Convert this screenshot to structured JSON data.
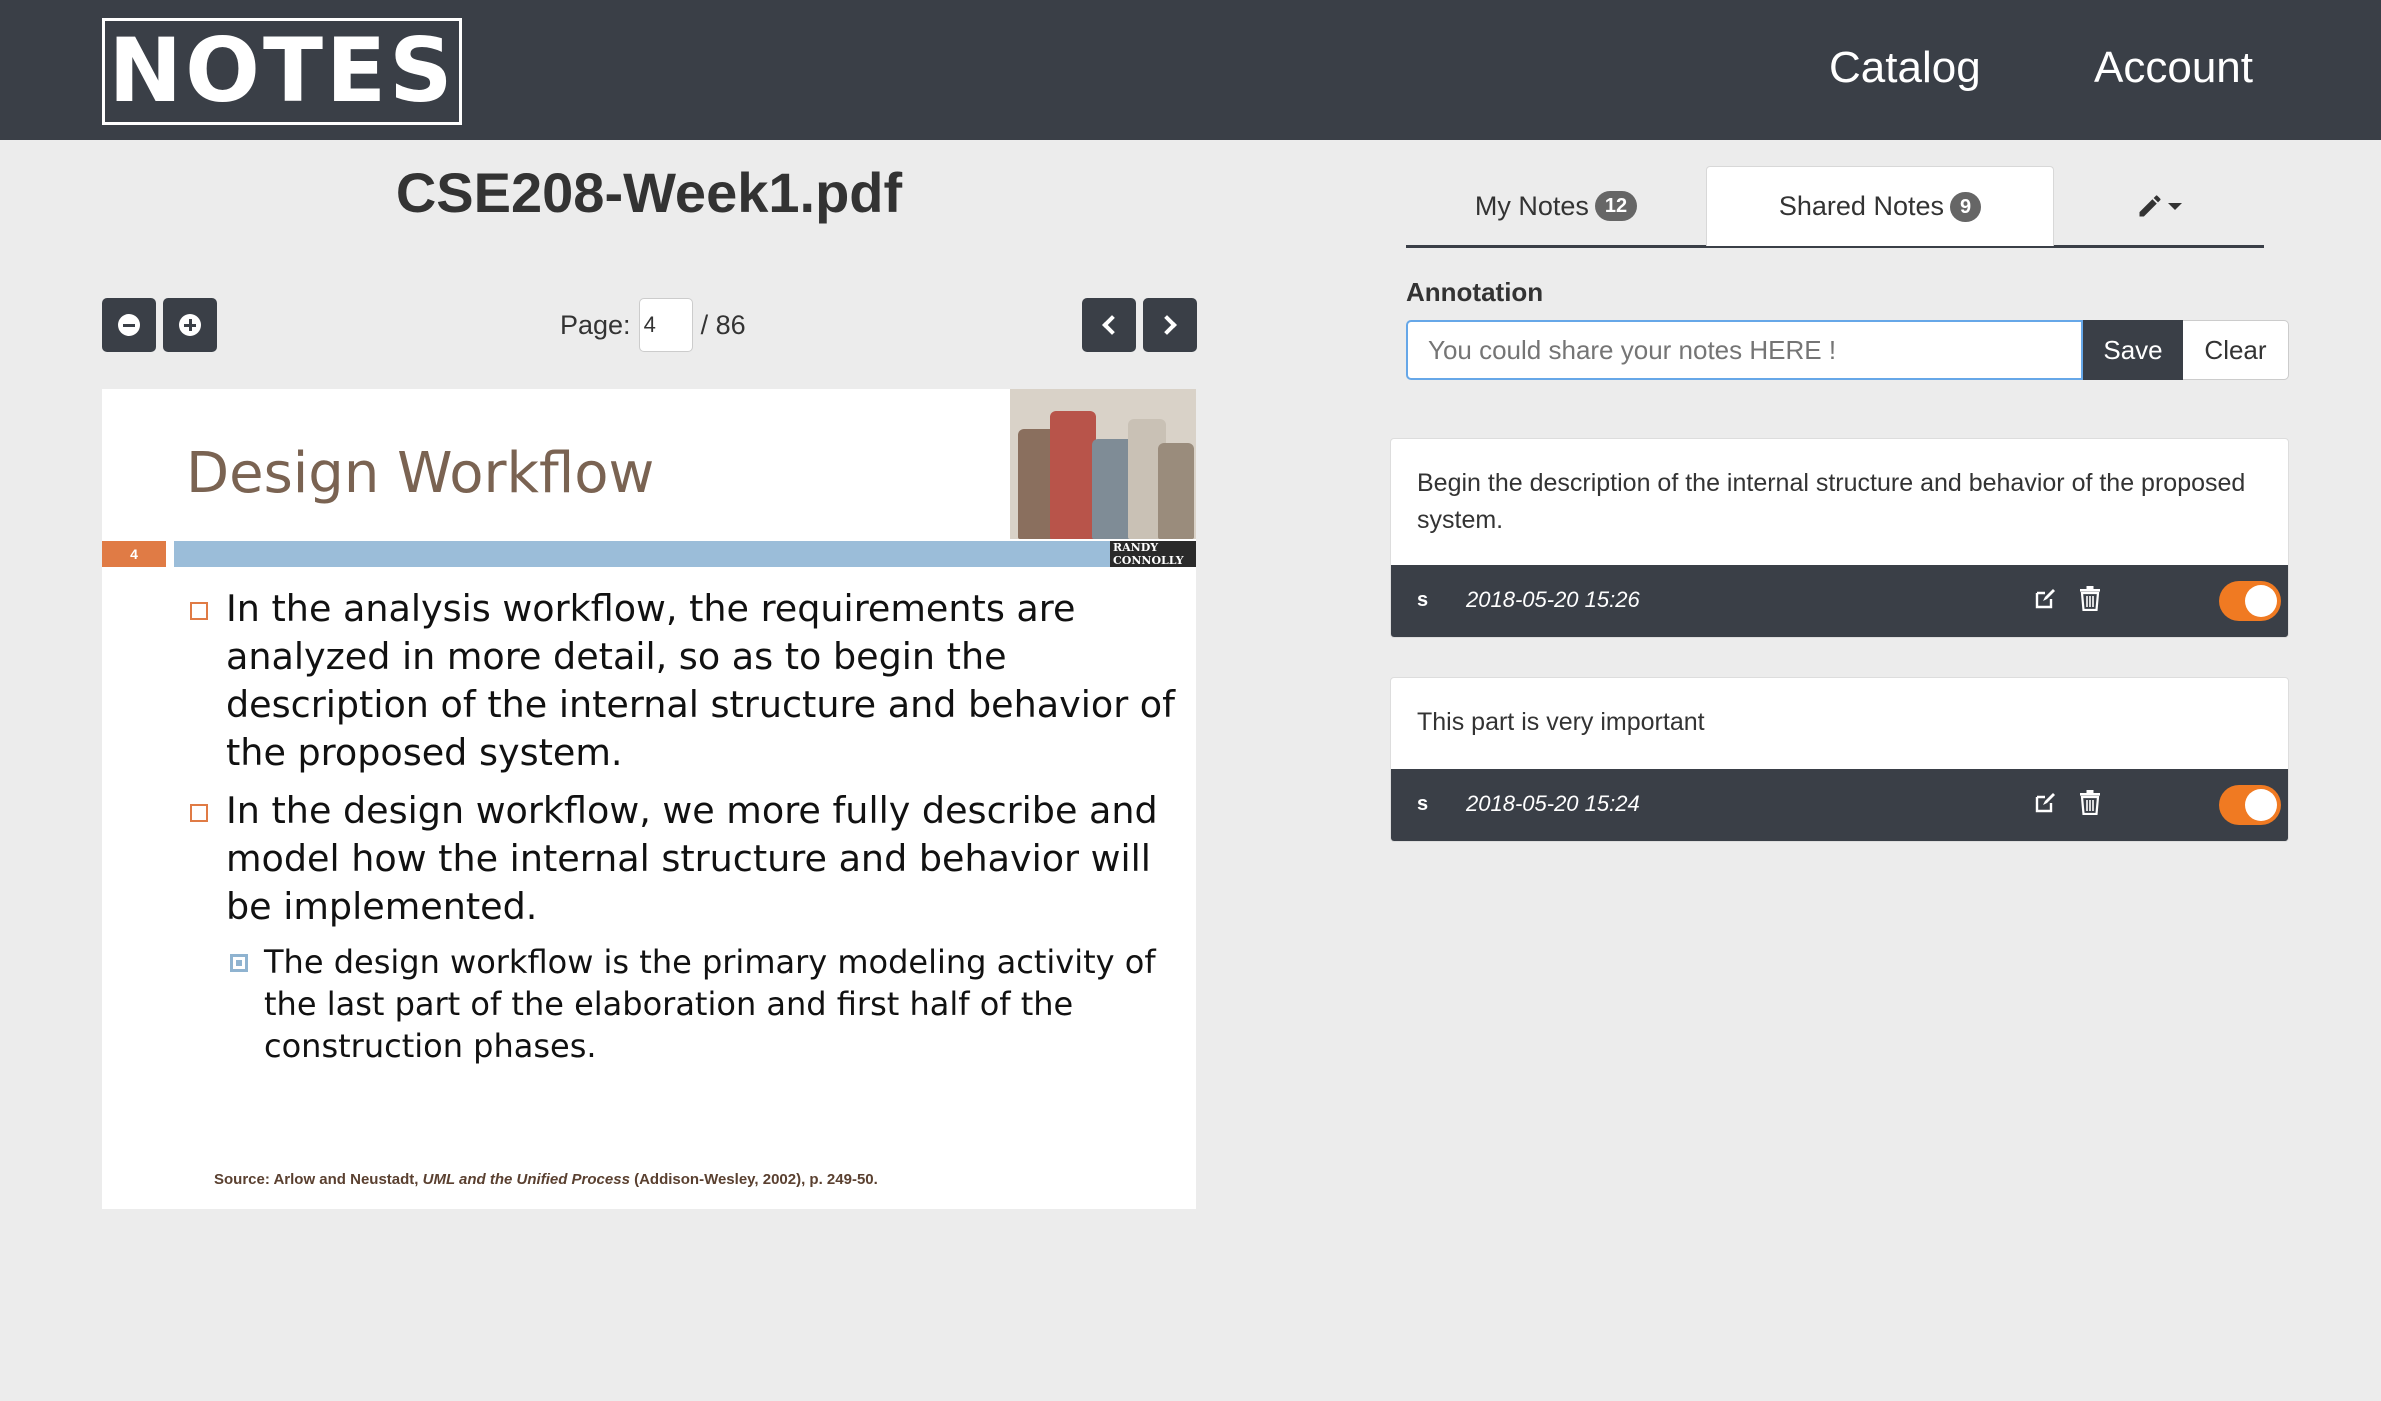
{
  "header": {
    "logo": "NOTES",
    "nav": {
      "catalog": "Catalog",
      "account": "Account"
    }
  },
  "viewer": {
    "doc_title": "CSE208-Week1.pdf",
    "page_label": "Page:",
    "current_page": "4",
    "total_pages": "/ 86",
    "slide": {
      "title": "Design Workflow",
      "slide_number": "4",
      "brand_line1": "RANDY",
      "brand_line2": "CONNOLLY",
      "bullets": [
        "In the analysis workflow, the requirements are analyzed in more detail, so as to begin the description of the internal structure and behavior of the proposed system.",
        "In the design workflow, we more fully describe and model how the internal structure and behavior will be implemented."
      ],
      "subbullet": "The design workflow is the primary modeling activity of the last part of the elaboration and first half of the construction phases.",
      "source_prefix": "Source: Arlow and Neustadt,",
      "source_title": "UML and the Unified Process",
      "source_suffix": "(Addison-Wesley, 2002), p. 249-50."
    }
  },
  "notes_panel": {
    "tabs": {
      "my_notes_label": "My Notes",
      "my_notes_count": "12",
      "shared_notes_label": "Shared Notes",
      "shared_notes_count": "9",
      "active": "Shared Notes"
    },
    "annotation": {
      "label": "Annotation",
      "placeholder": "You could share your notes HERE !",
      "save_label": "Save",
      "clear_label": "Clear"
    },
    "notes": [
      {
        "text": "Begin the description of the internal structure and behavior of the proposed system.",
        "user": "s",
        "timestamp": "2018-05-20 15:26",
        "shared": true
      },
      {
        "text": "This part is very important",
        "user": "s",
        "timestamp": "2018-05-20 15:24",
        "shared": true
      }
    ]
  },
  "colors": {
    "header_bg": "#3a3f47",
    "page_bg": "#ececec",
    "accent_orange": "#f07a22",
    "input_focus": "#66a7e8",
    "slide_title": "#7a6352",
    "slide_rule": "#9bbdd9"
  }
}
